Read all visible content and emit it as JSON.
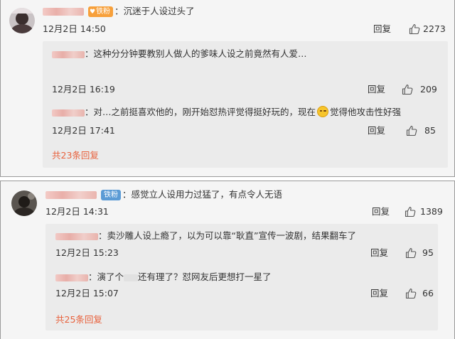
{
  "thread1": {
    "comment": {
      "badge": "铁粉",
      "text": "沉迷于人设过头了",
      "time": "12月2日 14:50",
      "reply": "回复",
      "likes": "2273"
    },
    "replies": [
      {
        "text": "这种分分钟要教别人做人的爹味人设之前竟然有人爱…",
        "time": "12月2日 16:19",
        "reply": "回复",
        "likes": "209"
      },
      {
        "text_before": "对…之前挺喜欢他的，刚开始怼热评觉得挺好玩的，现在",
        "text_after": "觉得他攻击性好强",
        "time": "12月2日 17:41",
        "reply": "回复",
        "likes": "85"
      }
    ],
    "more": "共23条回复"
  },
  "thread2": {
    "comment": {
      "badge": "铁粉",
      "text": "感觉立人设用力过猛了，有点令人无语",
      "time": "12月2日 14:31",
      "reply": "回复",
      "likes": "1389"
    },
    "replies": [
      {
        "text": "卖沙雕人设上瘾了，以为可以靠“耿直”宣传一波剧，结果翻车了",
        "time": "12月2日 15:23",
        "reply": "回复",
        "likes": "95"
      },
      {
        "text_before": "演了个",
        "text_after": "还有理了？怼网友后更想打一星了",
        "time": "12月2日 15:07",
        "reply": "回复",
        "likes": "66"
      }
    ],
    "more": "共25条回复"
  }
}
